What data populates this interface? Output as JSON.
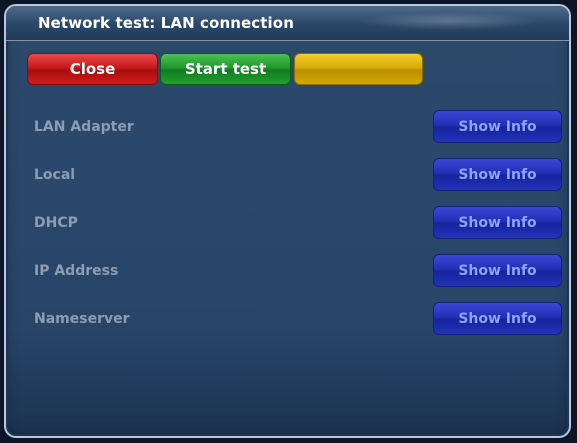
{
  "window": {
    "title": "Network test: LAN connection"
  },
  "buttons": {
    "red_label": "Close",
    "green_label": "Start test",
    "yellow_label": ""
  },
  "rows": [
    {
      "label": "LAN Adapter",
      "action": "Show Info"
    },
    {
      "label": "Local",
      "action": "Show Info"
    },
    {
      "label": "DHCP",
      "action": "Show Info"
    },
    {
      "label": "IP Address",
      "action": "Show Info"
    },
    {
      "label": "Nameserver",
      "action": "Show Info"
    }
  ],
  "colors": {
    "red": "#c81919",
    "green": "#1f9a2c",
    "yellow": "#d9ac07",
    "blue": "#2230b6",
    "background": "#29486a"
  }
}
